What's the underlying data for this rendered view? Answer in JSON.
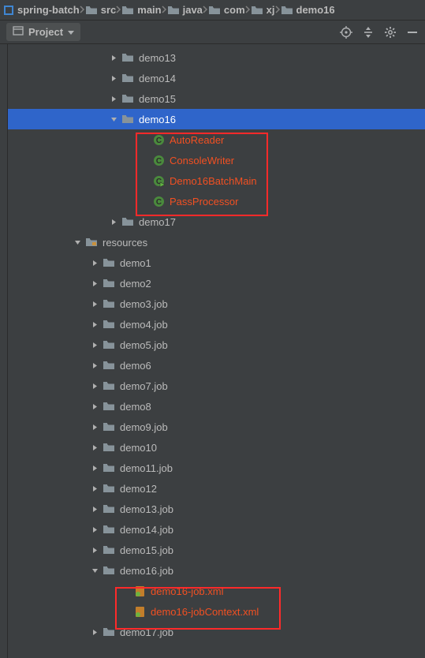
{
  "breadcrumbs": [
    "spring-batch",
    "src",
    "main",
    "java",
    "com",
    "xj",
    "demo16"
  ],
  "toolbar": {
    "project_label": "Project"
  },
  "tree": {
    "nodes": [
      {
        "indent": 128,
        "arrow": "right",
        "icon": "folder",
        "label": "demo13"
      },
      {
        "indent": 128,
        "arrow": "right",
        "icon": "folder",
        "label": "demo14"
      },
      {
        "indent": 128,
        "arrow": "right",
        "icon": "folder",
        "label": "demo15"
      },
      {
        "indent": 128,
        "arrow": "down",
        "icon": "folder",
        "label": "demo16",
        "selected": true
      },
      {
        "indent": 168,
        "arrow": "none",
        "icon": "class",
        "label": "AutoReader",
        "highlight": true
      },
      {
        "indent": 168,
        "arrow": "none",
        "icon": "class",
        "label": "ConsoleWriter",
        "highlight": true
      },
      {
        "indent": 168,
        "arrow": "none",
        "icon": "classrun",
        "label": "Demo16BatchMain",
        "highlight": true
      },
      {
        "indent": 168,
        "arrow": "none",
        "icon": "class",
        "label": "PassProcessor",
        "highlight": true
      },
      {
        "indent": 128,
        "arrow": "right",
        "icon": "folder",
        "label": "demo17"
      },
      {
        "indent": 82,
        "arrow": "down",
        "icon": "resources",
        "label": "resources"
      },
      {
        "indent": 104,
        "arrow": "right",
        "icon": "folder",
        "label": "demo1"
      },
      {
        "indent": 104,
        "arrow": "right",
        "icon": "folder",
        "label": "demo2"
      },
      {
        "indent": 104,
        "arrow": "right",
        "icon": "folder",
        "label": "demo3.job"
      },
      {
        "indent": 104,
        "arrow": "right",
        "icon": "folder",
        "label": "demo4.job"
      },
      {
        "indent": 104,
        "arrow": "right",
        "icon": "folder",
        "label": "demo5.job"
      },
      {
        "indent": 104,
        "arrow": "right",
        "icon": "folder",
        "label": "demo6"
      },
      {
        "indent": 104,
        "arrow": "right",
        "icon": "folder",
        "label": "demo7.job"
      },
      {
        "indent": 104,
        "arrow": "right",
        "icon": "folder",
        "label": "demo8"
      },
      {
        "indent": 104,
        "arrow": "right",
        "icon": "folder",
        "label": "demo9.job"
      },
      {
        "indent": 104,
        "arrow": "right",
        "icon": "folder",
        "label": "demo10"
      },
      {
        "indent": 104,
        "arrow": "right",
        "icon": "folder",
        "label": "demo11.job"
      },
      {
        "indent": 104,
        "arrow": "right",
        "icon": "folder",
        "label": "demo12"
      },
      {
        "indent": 104,
        "arrow": "right",
        "icon": "folder",
        "label": "demo13.job"
      },
      {
        "indent": 104,
        "arrow": "right",
        "icon": "folder",
        "label": "demo14.job"
      },
      {
        "indent": 104,
        "arrow": "right",
        "icon": "folder",
        "label": "demo15.job"
      },
      {
        "indent": 104,
        "arrow": "down",
        "icon": "folder",
        "label": "demo16.job"
      },
      {
        "indent": 144,
        "arrow": "none",
        "icon": "spring",
        "label": "demo16-job.xml",
        "highlight": true
      },
      {
        "indent": 144,
        "arrow": "none",
        "icon": "spring",
        "label": "demo16-jobContext.xml",
        "highlight": true
      },
      {
        "indent": 104,
        "arrow": "right",
        "icon": "folder",
        "label": "demo17.job"
      }
    ]
  }
}
